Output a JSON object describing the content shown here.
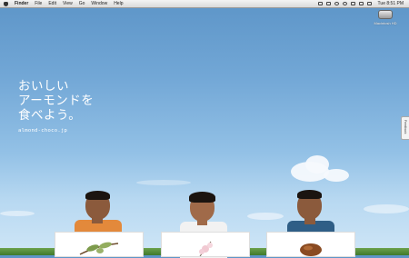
{
  "menubar": {
    "app_name": "Finder",
    "items": [
      "File",
      "Edit",
      "View",
      "Go",
      "Window",
      "Help"
    ],
    "clock": "Tue 8:51 PM"
  },
  "desktop": {
    "drive_label": "Macintosh HD"
  },
  "hero": {
    "headline_lines": [
      "おいしい",
      "アーモンドを",
      "食べよう。"
    ],
    "url": "almond-choco.jp"
  },
  "side_tab": {
    "label": "Feedback"
  },
  "colors": {
    "sky_top": "#5d95c8",
    "sky_bottom": "#cfe6f7",
    "grass": "#4f8a36",
    "shirt_orange": "#e3893b",
    "shirt_white": "#f2f2f2",
    "shirt_blue": "#2f5e86"
  },
  "icons": [
    "apple-icon",
    "dropbox-icon",
    "screen-icon",
    "wifi-icon",
    "volume-icon",
    "battery-icon",
    "time-machine-icon",
    "sync-icon",
    "harddrive-icon"
  ]
}
